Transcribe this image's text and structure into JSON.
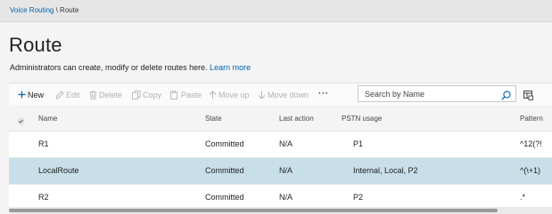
{
  "breadcrumb": {
    "link": "Voice Routing",
    "separator": " \\ ",
    "current": "Route"
  },
  "page": {
    "title": "Route",
    "description": "Administrators can create, modify or delete routes here.",
    "learn_more": "Learn more"
  },
  "toolbar": {
    "new": "New",
    "edit": "Edit",
    "delete": "Delete",
    "copy": "Copy",
    "paste": "Paste",
    "move_up": "Move up",
    "move_down": "Move down",
    "more": "···",
    "search_placeholder": "Search by Name"
  },
  "icons": {
    "new": "plus-icon",
    "edit": "pencil-icon",
    "delete": "trash-icon",
    "copy": "copy-icon",
    "paste": "paste-icon",
    "move_up": "arrow-up-icon",
    "move_down": "arrow-down-icon",
    "search": "search-icon",
    "columns": "column-picker-icon",
    "select_all": "checkmark-icon"
  },
  "colors": {
    "accent": "#0063b1",
    "selected_row": "#c8dfe9",
    "disabled": "#b0b0b0"
  },
  "table": {
    "columns": [
      "Name",
      "State",
      "Last action",
      "PSTN usage",
      "Pattern"
    ],
    "rows": [
      {
        "name": "R1",
        "state": "Committed",
        "last_action": "N/A",
        "pstn_usage": "P1",
        "pattern": "^12(?!",
        "selected": false
      },
      {
        "name": "LocalRoute",
        "state": "Committed",
        "last_action": "N/A",
        "pstn_usage": "Internal, Local, P2",
        "pattern": "^(\\+1)",
        "selected": true
      },
      {
        "name": "R2",
        "state": "Committed",
        "last_action": "N/A",
        "pstn_usage": "P2",
        "pattern": ".*",
        "selected": false
      }
    ]
  }
}
